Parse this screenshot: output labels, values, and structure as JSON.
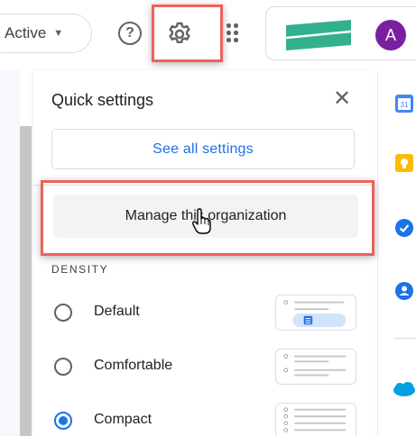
{
  "topbar": {
    "status_label": "Active",
    "help_icon_glyph": "?",
    "avatar_letter": "A"
  },
  "quick_settings": {
    "title": "Quick settings",
    "close_glyph": "✕",
    "see_all_label": "See all settings",
    "manage_org_label": "Manage this organization"
  },
  "density": {
    "heading": "DENSITY",
    "options": [
      {
        "label": "Default",
        "selected": false
      },
      {
        "label": "Comfortable",
        "selected": false
      },
      {
        "label": "Compact",
        "selected": true
      }
    ]
  },
  "side_rail": {
    "icons": [
      "calendar-icon",
      "keep-icon",
      "tasks-icon",
      "contacts-icon",
      "salesforce-icon"
    ],
    "calendar_day": "31"
  },
  "colors": {
    "accent": "#1a73e8",
    "highlight": "#f0605b",
    "avatar": "#7b1fa2",
    "logo": "#33b08c"
  }
}
